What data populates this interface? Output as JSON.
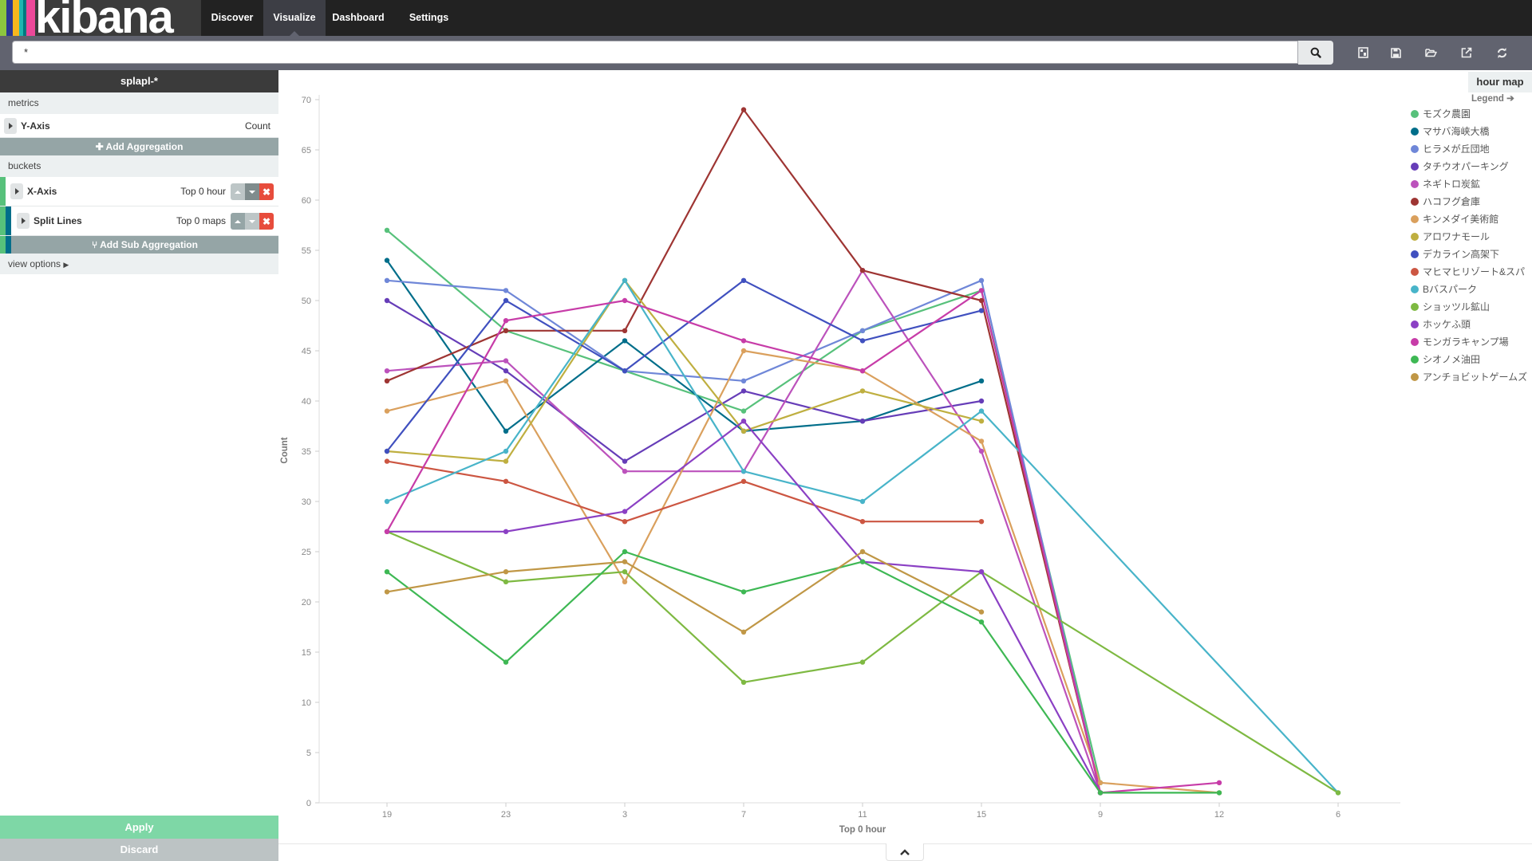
{
  "navbar": {
    "logo_text": "kibana",
    "logo_stripes": [
      "#8cc63f",
      "#2b3990",
      "#f7b71e",
      "#1fb6b0",
      "#00787f",
      "#ec4899"
    ],
    "items": [
      {
        "label": "Discover",
        "active": false
      },
      {
        "label": "Visualize",
        "active": true
      },
      {
        "label": "Dashboard",
        "active": false
      },
      {
        "label": "Settings",
        "active": false
      }
    ]
  },
  "search": {
    "value": "*",
    "button_icon": "search-icon",
    "tools": [
      "new-visualization-icon",
      "save-icon",
      "open-folder-icon",
      "share-icon",
      "refresh-icon"
    ]
  },
  "sidebar": {
    "index_pattern": "splapl-*",
    "metrics_label": "metrics",
    "metrics": [
      {
        "name": "Y-Axis",
        "desc": "Count"
      }
    ],
    "add_aggregation_label": "Add Aggregation",
    "buckets_label": "buckets",
    "buckets": [
      {
        "name": "X-Axis",
        "desc": "Top 0 hour",
        "color": "#57c17b"
      },
      {
        "name": "Split Lines",
        "desc": "Top 0 maps",
        "color": "#006e8a"
      }
    ],
    "add_sub_aggregation_label": "Add Sub Aggregation",
    "view_options_label": "view options",
    "apply_label": "Apply",
    "discard_label": "Discard"
  },
  "visualization": {
    "title": "hour map",
    "legend_label": "Legend"
  },
  "chart_data": {
    "type": "line",
    "title": "hour map",
    "xlabel": "Top 0 hour",
    "ylabel": "Count",
    "categories": [
      "19",
      "23",
      "3",
      "7",
      "11",
      "15",
      "9",
      "12",
      "6"
    ],
    "ylim": [
      0,
      70
    ],
    "yticks": [
      0,
      5,
      10,
      15,
      20,
      25,
      30,
      35,
      40,
      45,
      50,
      55,
      60,
      65,
      70
    ],
    "grid": false,
    "legend_position": "right",
    "series": [
      {
        "name": "モズク農園",
        "color": "#57c17b",
        "values": [
          57,
          47,
          43,
          39,
          47,
          51,
          2,
          null,
          null
        ]
      },
      {
        "name": "マサバ海峡大橋",
        "color": "#006e8a",
        "values": [
          54,
          37,
          46,
          37,
          38,
          42,
          null,
          null,
          null
        ]
      },
      {
        "name": "ヒラメが丘団地",
        "color": "#6f87d8",
        "values": [
          52,
          51,
          43,
          42,
          47,
          52,
          1,
          null,
          null
        ]
      },
      {
        "name": "タチウオパーキング",
        "color": "#663db8",
        "values": [
          50,
          43,
          34,
          41,
          38,
          40,
          null,
          null,
          null
        ]
      },
      {
        "name": "ネギトロ炭鉱",
        "color": "#bc52bc",
        "values": [
          43,
          44,
          33,
          33,
          53,
          35,
          1,
          null,
          null
        ]
      },
      {
        "name": "ハコフグ倉庫",
        "color": "#9e3533",
        "values": [
          42,
          47,
          47,
          69,
          53,
          50,
          1,
          null,
          null
        ]
      },
      {
        "name": "キンメダイ美術館",
        "color": "#daa05d",
        "values": [
          39,
          42,
          22,
          45,
          43,
          36,
          2,
          1,
          null
        ]
      },
      {
        "name": "アロワナモール",
        "color": "#bfaf40",
        "values": [
          35,
          34,
          52,
          37,
          41,
          38,
          null,
          null,
          null
        ]
      },
      {
        "name": "デカライン高架下",
        "color": "#4050bf",
        "values": [
          35,
          50,
          43,
          52,
          46,
          49,
          null,
          null,
          null
        ]
      },
      {
        "name": "マヒマヒリゾート&スパ",
        "color": "#cc5642",
        "values": [
          34,
          32,
          28,
          32,
          28,
          28,
          null,
          null,
          null
        ]
      },
      {
        "name": "Bバスパーク",
        "color": "#48b4c9",
        "values": [
          30,
          35,
          52,
          33,
          30,
          39,
          null,
          null,
          1
        ]
      },
      {
        "name": "ショッツル鉱山",
        "color": "#7eb942",
        "values": [
          27,
          22,
          23,
          12,
          14,
          23,
          null,
          null,
          1
        ]
      },
      {
        "name": "ホッケふ頭",
        "color": "#8b40c4",
        "values": [
          27,
          27,
          29,
          38,
          24,
          23,
          1,
          null,
          null
        ]
      },
      {
        "name": "モンガラキャンプ場",
        "color": "#c73ca8",
        "values": [
          27,
          48,
          50,
          46,
          43,
          51,
          1,
          2,
          null
        ]
      },
      {
        "name": "シオノメ油田",
        "color": "#3eb854",
        "values": [
          23,
          14,
          25,
          21,
          24,
          18,
          1,
          1,
          null
        ]
      },
      {
        "name": "アンチョビットゲームズ",
        "color": "#c09746",
        "values": [
          21,
          23,
          24,
          17,
          25,
          19,
          null,
          null,
          null
        ]
      }
    ]
  }
}
